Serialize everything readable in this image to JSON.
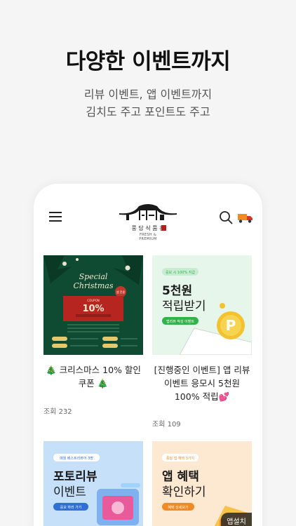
{
  "headline": "다양한 이벤트까지",
  "subline": [
    "리뷰 이벤트, 앱 이벤트까지",
    "김치도 주고 포인트도 주고"
  ],
  "header": {
    "menu_icon": "hamburger-icon",
    "logo_text": "풍 담 식 품 관",
    "logo_tagline": "FRESH & PREMIUM",
    "search_icon": "search-icon",
    "delivery_icon": "truck-icon"
  },
  "events": [
    {
      "title": "🎄 크리스마스 10% 할인 쿠폰 🎄",
      "views": "조회 232",
      "image": {
        "heading": "Special Christmas",
        "coupon_label": "COUPON",
        "discount": "10%",
        "badge": "앱 전용"
      }
    },
    {
      "title": "[진행중인 이벤트] 앱 리뷰 이벤트 응모시 5천원 100% 적립💕",
      "views": "조회 109",
      "image": {
        "tag": "응모 시 100% 지급",
        "line1": "5천원",
        "line2": "적립받기",
        "button": "앱리뷰 작성 이벤트"
      }
    },
    {
      "image": {
        "tag": "매월 베스트리뷰어 3명",
        "line1": "포토리뷰",
        "line2": "이벤트",
        "button": "응모 하러 가기"
      }
    },
    {
      "image": {
        "tag": "풍담 앱 혜택 3가지",
        "line1": "앱 혜택",
        "line2": "확인하기",
        "button": "혜택 상세보기"
      }
    }
  ],
  "install_button": "앱설치",
  "colors": {
    "christmas_green": "#0f4a32",
    "accent_red": "#c0392b",
    "point_green": "#2fb34a",
    "photo_blue": "#2f6fd6",
    "app_orange": "#f08a24"
  }
}
